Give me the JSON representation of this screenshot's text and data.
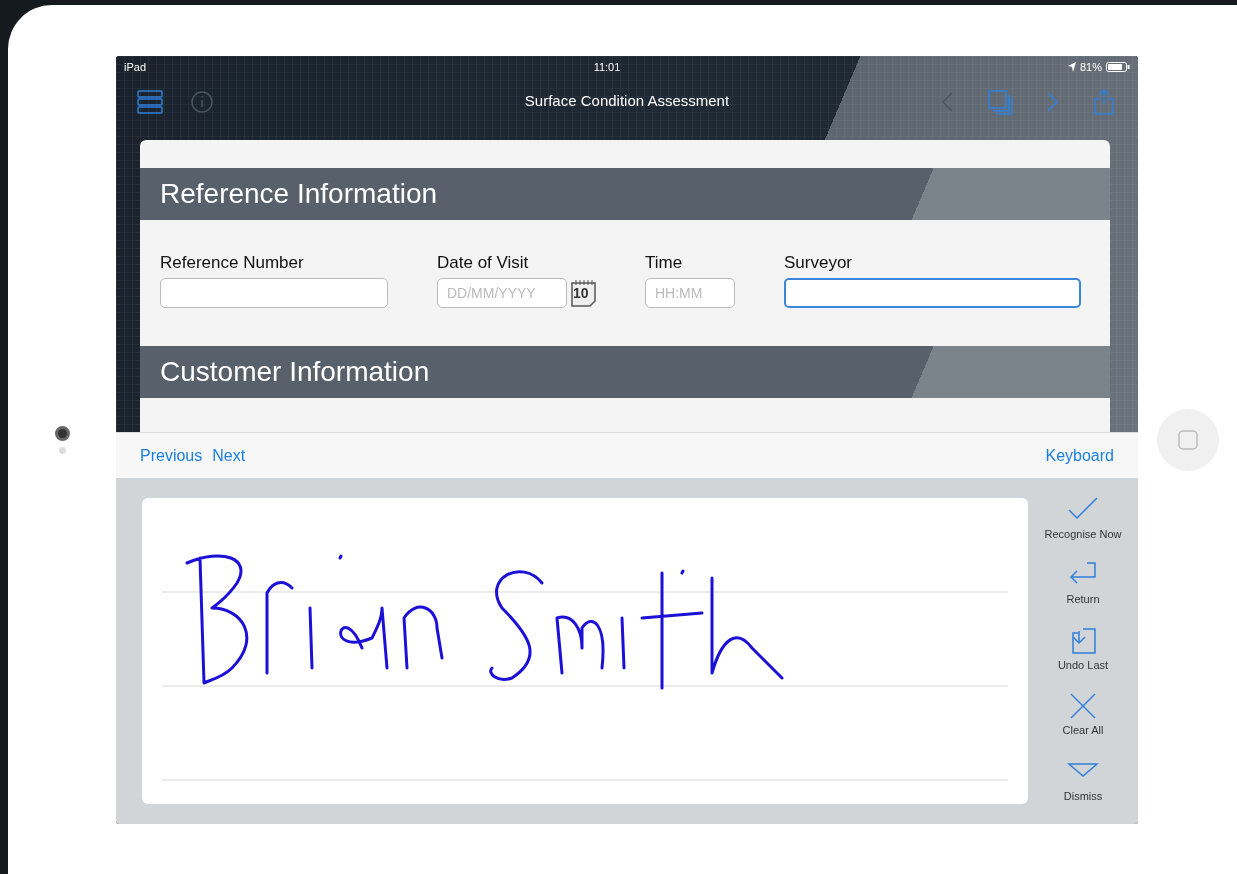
{
  "status_bar": {
    "carrier": "iPad",
    "time": "11:01",
    "battery": "81%"
  },
  "nav_bar": {
    "title": "Surface Condition Assessment",
    "left_icons": [
      {
        "kind": "menu",
        "disabled": false
      },
      {
        "kind": "info",
        "disabled": true
      }
    ],
    "right_icons": [
      {
        "kind": "back",
        "disabled": true
      },
      {
        "kind": "copy",
        "disabled": false
      },
      {
        "kind": "forward",
        "disabled": false
      },
      {
        "kind": "share",
        "disabled": false
      }
    ]
  },
  "sections": [
    {
      "title": "Reference Information",
      "fields": [
        {
          "label": "Reference Number",
          "focused": false
        },
        {
          "label": "Date of Visit",
          "placeholder": "DD/MM/YYYY",
          "calendar_day": "10",
          "focused": false
        },
        {
          "label": "Time",
          "placeholder": "HH:MM",
          "focused": false
        },
        {
          "label": "Surveyor",
          "focused": true
        }
      ]
    },
    {
      "title": "Customer Information"
    }
  ],
  "accessory_bar": {
    "previous": "Previous",
    "next": "Next",
    "keyboard": "Keyboard"
  },
  "handwriting_tools": [
    {
      "kind": "check",
      "label": "Recognise Now"
    },
    {
      "kind": "return",
      "label": "Return"
    },
    {
      "kind": "undo",
      "label": "Undo Last"
    },
    {
      "kind": "clear",
      "label": "Clear All"
    },
    {
      "kind": "dismiss",
      "label": "Dismiss"
    }
  ]
}
